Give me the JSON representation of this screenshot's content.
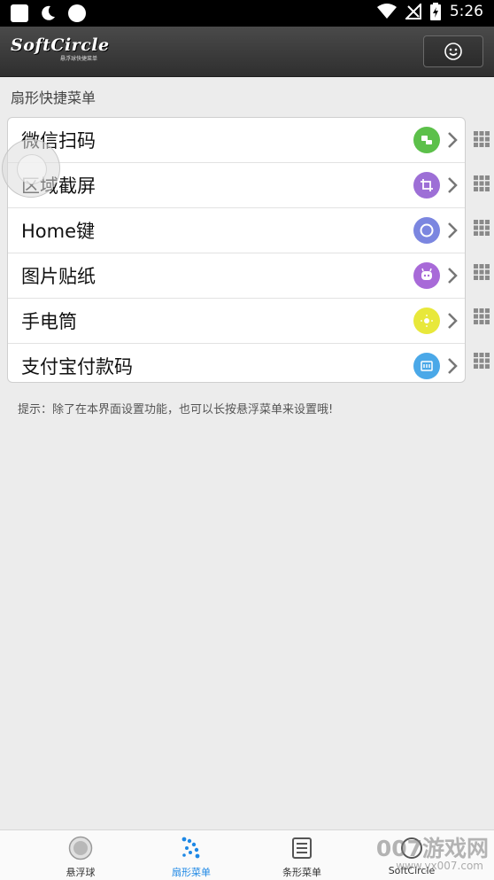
{
  "status_bar": {
    "time": "5:26"
  },
  "app_bar": {
    "logo": "SoftCircle",
    "logo_sub": "悬浮球快捷菜单"
  },
  "section_title": "扇形快捷菜单",
  "menu_items": [
    {
      "label": "微信扫码",
      "icon": "wechat-scan-icon",
      "color": "#5cc04a"
    },
    {
      "label": "区域截屏",
      "icon": "crop-icon",
      "color": "#9d6fd6"
    },
    {
      "label": "Home键",
      "icon": "home-circle-icon",
      "color": "#7b86e0"
    },
    {
      "label": "图片贴纸",
      "icon": "sticker-icon",
      "color": "#a86ad8"
    },
    {
      "label": "手电筒",
      "icon": "flashlight-icon",
      "color": "#e8e83b"
    },
    {
      "label": "支付宝付款码",
      "icon": "alipay-code-icon",
      "color": "#4aa8e8"
    }
  ],
  "hint": "提示：除了在本界面设置功能，也可以长按悬浮菜单来设置哦!",
  "bottom_nav": {
    "tabs": [
      {
        "label": "悬浮球",
        "icon": "ball-icon"
      },
      {
        "label": "扇形菜单",
        "icon": "fan-dots-icon",
        "active": true
      },
      {
        "label": "条形菜单",
        "icon": "list-icon"
      },
      {
        "label": "SoftCircle",
        "icon": "softcircle-icon"
      }
    ]
  },
  "watermark": {
    "text": "007游戏网",
    "sub": "www.yx007.com"
  }
}
